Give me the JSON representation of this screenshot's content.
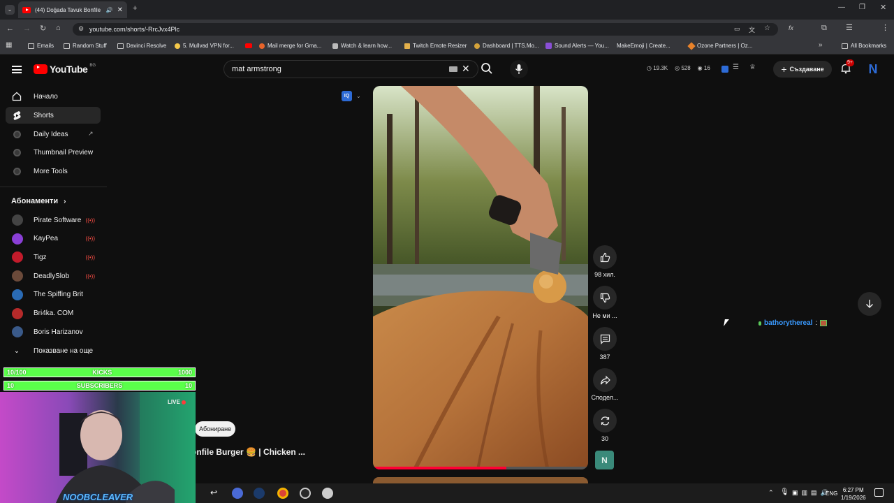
{
  "browser": {
    "tab_title": "(44) Doğada Tavuk Bonfile",
    "url": "youtube.com/shorts/-RrcJvx4Plc",
    "bookmarks": [
      "Emails",
      "Random Stuff",
      "Davinci Resolve",
      "5. Mullvad VPN for...",
      "Mail merge for Gma...",
      "Watch & learn how...",
      "Twitch Emote Resizer",
      "Dashboard | TTS.Mo...",
      "Sound Alerts — You...",
      "MakeEmoji | Create...",
      "Ozone Partners | Oz..."
    ],
    "all_bookmarks": "All Bookmarks"
  },
  "header": {
    "logo_text": "YouTube",
    "country_code": "BG",
    "search_value": "mat armstrong",
    "stats": [
      "19.3K",
      "528",
      "16"
    ],
    "create_label": "Създаване",
    "notif_count": "9+",
    "avatar_letter": "N"
  },
  "sidebar": {
    "items": [
      {
        "label": "Начало",
        "icon": "home-icon"
      },
      {
        "label": "Shorts",
        "icon": "shorts-icon"
      },
      {
        "label": "Daily Ideas",
        "icon": "ext-icon"
      },
      {
        "label": "Thumbnail Preview",
        "icon": "ext-icon"
      },
      {
        "label": "More Tools",
        "icon": "ext-icon"
      }
    ],
    "subs_heading": "Абонаменти",
    "subscriptions": [
      {
        "label": "Pirate Software",
        "live": true,
        "color": "#444444"
      },
      {
        "label": "KayPea",
        "live": true,
        "color": "#8a3fd6"
      },
      {
        "label": "Tigz",
        "live": true,
        "color": "#c21b2b"
      },
      {
        "label": "DeadlySlob",
        "live": true,
        "color": "#6b4a3a"
      },
      {
        "label": "The Spiffing Brit",
        "live": false,
        "color": "#2a6bb5"
      },
      {
        "label": "Bri4ka. COM",
        "live": false,
        "color": "#b52a2a"
      },
      {
        "label": "Boris Harizanov",
        "live": false,
        "color": "#3a5a8a"
      }
    ],
    "show_more": "Показване на още"
  },
  "short": {
    "title": "onfile Burger 🍔 | Chicken ...",
    "subscribe": "Абониране",
    "likes": "98 хил.",
    "dislike": "Не ми ...",
    "comments": "387",
    "share": "Сподел...",
    "remix": "30",
    "channel_badge": "N",
    "progress": 0.62
  },
  "chat": {
    "user": "bathorythereal",
    "sep": ":"
  },
  "overlay": {
    "kicks_left": "10/100",
    "kicks_label": "KICKS",
    "kicks_right": "1000",
    "subs_left": "10",
    "subs_label": "SUBSCRIBERS",
    "subs_right": "10",
    "live_label": "LIVE",
    "streamer_name": "NOOBCLEAVER"
  },
  "taskbar": {
    "lang": "ENG",
    "time": "6:27 PM",
    "date": "1/19/2026"
  }
}
